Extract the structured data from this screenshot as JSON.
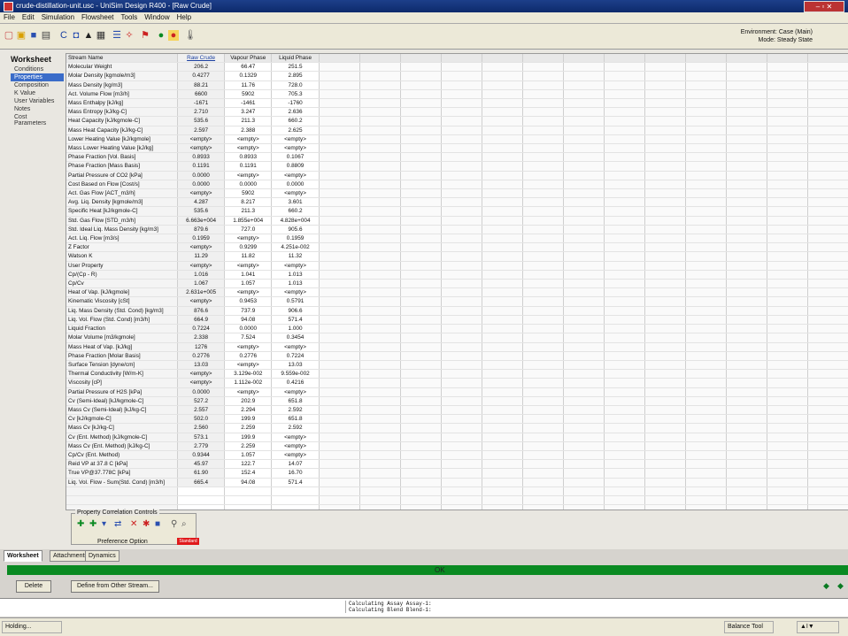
{
  "window": {
    "title": "crude-distillation-unit.usc - UniSim Design R400 - [Raw Crude]",
    "controls": "– ▫ ✕"
  },
  "menu": [
    "File",
    "Edit",
    "Simulation",
    "Flowsheet",
    "Tools",
    "Window",
    "Help"
  ],
  "toolbar": {
    "icons": [
      "new-icon",
      "open-icon",
      "save-icon",
      "print-icon",
      "component-icon",
      "fluid-package-icon",
      "oil-icon",
      "workbook-icon",
      "pfd-icon",
      "reaction-icon",
      "solver-active-icon",
      "solver-hold-icon",
      "thermometer-icon"
    ],
    "environment": "Environment: Case (Main)",
    "mode": "Mode: Steady State"
  },
  "nav": {
    "heading": "Worksheet",
    "items": [
      "Conditions",
      "Properties",
      "Composition",
      "K Value",
      "User Variables",
      "Notes",
      "Cost Parameters"
    ],
    "selected": 1
  },
  "table": {
    "columns": [
      "Stream Name",
      "Raw Crude",
      "Vapour Phase",
      "Liquid Phase"
    ],
    "rows": [
      [
        "Molecular Weight",
        "206.2",
        "66.47",
        "251.5"
      ],
      [
        "Molar Density [kgmole/m3]",
        "0.4277",
        "0.1329",
        "2.895"
      ],
      [
        "Mass Density [kg/m3]",
        "88.21",
        "11.76",
        "728.0"
      ],
      [
        "Act. Volume Flow [m3/h]",
        "6600",
        "5902",
        "705.3"
      ],
      [
        "Mass Enthalpy [kJ/kg]",
        "-1671",
        "-1461",
        "-1760"
      ],
      [
        "Mass Entropy [kJ/kg-C]",
        "2.710",
        "3.247",
        "2.636"
      ],
      [
        "Heat Capacity [kJ/kgmole-C]",
        "535.6",
        "211.3",
        "660.2"
      ],
      [
        "Mass Heat Capacity [kJ/kg-C]",
        "2.597",
        "2.388",
        "2.625"
      ],
      [
        "Lower Heating Value [kJ/kgmole]",
        "<empty>",
        "<empty>",
        "<empty>"
      ],
      [
        "Mass Lower Heating Value [kJ/kg]",
        "<empty>",
        "<empty>",
        "<empty>"
      ],
      [
        "Phase Fraction [Vol. Basis]",
        "0.8933",
        "0.8933",
        "0.1067"
      ],
      [
        "Phase Fraction [Mass Basis]",
        "0.1191",
        "0.1191",
        "0.8809"
      ],
      [
        "Partial Pressure of CO2 [kPa]",
        "0.0000",
        "<empty>",
        "<empty>"
      ],
      [
        "Cost Based on Flow [Cost/s]",
        "0.0000",
        "0.0000",
        "0.0000"
      ],
      [
        "Act. Gas Flow [ACT_m3/h]",
        "<empty>",
        "5902",
        "<empty>"
      ],
      [
        "Avg. Liq. Density [kgmole/m3]",
        "4.287",
        "8.217",
        "3.601"
      ],
      [
        "Specific Heat [kJ/kgmole-C]",
        "535.6",
        "211.3",
        "660.2"
      ],
      [
        "Std. Gas Flow [STD_m3/h]",
        "6.663e+004",
        "1.855e+004",
        "4.828e+004"
      ],
      [
        "Std. Ideal Liq. Mass Density [kg/m3]",
        "879.6",
        "727.0",
        "905.6"
      ],
      [
        "Act. Liq. Flow [m3/s]",
        "0.1959",
        "<empty>",
        "0.1959"
      ],
      [
        "Z Factor",
        "<empty>",
        "0.9299",
        "4.251e-002"
      ],
      [
        "Watson K",
        "11.29",
        "11.82",
        "11.32"
      ],
      [
        "User Property",
        "<empty>",
        "<empty>",
        "<empty>"
      ],
      [
        "Cp/(Cp - R)",
        "1.016",
        "1.041",
        "1.013"
      ],
      [
        "Cp/Cv",
        "1.067",
        "1.057",
        "1.013"
      ],
      [
        "Heat of Vap. [kJ/kgmole]",
        "2.631e+005",
        "<empty>",
        "<empty>"
      ],
      [
        "Kinematic Viscosity [cSt]",
        "<empty>",
        "0.9453",
        "0.5791"
      ],
      [
        "Liq. Mass Density (Std. Cond) [kg/m3]",
        "876.6",
        "737.9",
        "906.6"
      ],
      [
        "Liq. Vol. Flow (Std. Cond) [m3/h]",
        "664.9",
        "94.08",
        "571.4"
      ],
      [
        "Liquid Fraction",
        "0.7224",
        "0.0000",
        "1.000"
      ],
      [
        "Molar Volume [m3/kgmole]",
        "2.338",
        "7.524",
        "0.3454"
      ],
      [
        "Mass Heat of Vap. [kJ/kg]",
        "1276",
        "<empty>",
        "<empty>"
      ],
      [
        "Phase Fraction [Molar Basis]",
        "0.2776",
        "0.2776",
        "0.7224"
      ],
      [
        "Surface Tension [dyne/cm]",
        "13.03",
        "<empty>",
        "13.03"
      ],
      [
        "Thermal Conductivity [W/m-K]",
        "<empty>",
        "3.129e-002",
        "9.559e-002"
      ],
      [
        "Viscosity [cP]",
        "<empty>",
        "1.112e-002",
        "0.4216"
      ],
      [
        "Partial Pressure of H2S [kPa]",
        "0.0000",
        "<empty>",
        "<empty>"
      ],
      [
        "Cv (Semi-Ideal) [kJ/kgmole-C]",
        "527.2",
        "202.9",
        "651.8"
      ],
      [
        "Mass Cv (Semi-Ideal) [kJ/kg-C]",
        "2.557",
        "2.294",
        "2.592"
      ],
      [
        "Cv [kJ/kgmole-C]",
        "502.0",
        "199.9",
        "651.8"
      ],
      [
        "Mass Cv [kJ/kg-C]",
        "2.560",
        "2.259",
        "2.592"
      ],
      [
        "Cv (Ent. Method) [kJ/kgmole-C]",
        "573.1",
        "199.9",
        "<empty>"
      ],
      [
        "Mass Cv (Ent. Method) [kJ/kg-C]",
        "2.779",
        "2.259",
        "<empty>"
      ],
      [
        "Cp/Cv (Ent. Method)",
        "0.9344",
        "1.057",
        "<empty>"
      ],
      [
        "Reid VP at 37.8 C [kPa]",
        "45.97",
        "122.7",
        "14.07"
      ],
      [
        "True VP@37.778C [kPa]",
        "61.90",
        "152.4",
        "16.70"
      ],
      [
        "Liq. Vol. Flow - Sum(Std. Cond) [m3/h]",
        "665.4",
        "94.08",
        "571.4"
      ]
    ]
  },
  "property_controls": {
    "label": "Property Correlation Controls",
    "preference_label": "Preference Option",
    "preference_value": "Standard"
  },
  "tabs": [
    "Worksheet",
    "Attachments",
    "Dynamics"
  ],
  "progress": {
    "label": "OK"
  },
  "buttons": {
    "delete": "Delete",
    "define": "Define from Other Stream..."
  },
  "log": [
    "Calculating Assay Assay-1:",
    "Calculating Blend Blend-1:"
  ],
  "status": {
    "left": "Holding...",
    "mid": "Balance Tool",
    "right": "▲I▼"
  }
}
